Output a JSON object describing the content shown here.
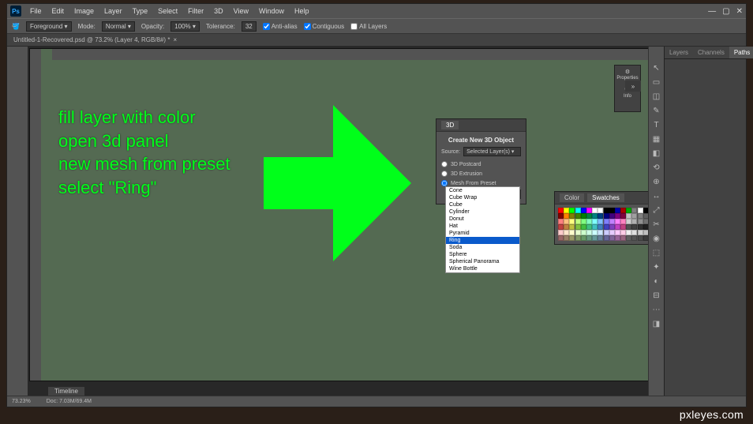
{
  "app": {
    "logo": "Ps"
  },
  "menu": [
    "File",
    "Edit",
    "Image",
    "Layer",
    "Type",
    "Select",
    "Filter",
    "3D",
    "View",
    "Window",
    "Help"
  ],
  "winctrl": {
    "min": "—",
    "max": "▢",
    "close": "✕"
  },
  "options": {
    "fill_label": "Foreground ▾",
    "mode_label": "Mode:",
    "mode_value": "Normal ▾",
    "opacity_label": "Opacity:",
    "opacity_value": "100% ▾",
    "tolerance_label": "Tolerance:",
    "tolerance_value": "32",
    "antialias": "Anti-alias",
    "contiguous": "Contiguous",
    "alllayers": "All Layers"
  },
  "doctab": {
    "title": "Untitled-1-Recovered.psd @ 73.2% (Layer 4, RGB/8#) *",
    "close": "×"
  },
  "tutorial": {
    "l1": "fill layer with color",
    "l2": "open 3d panel",
    "l3": "new mesh from preset",
    "l4": "select \"Ring\""
  },
  "three_d": {
    "tab": "3D",
    "title": "Create New 3D Object",
    "source_label": "Source:",
    "source_value": "Selected Layer(s) ▾",
    "opt_postcard": "3D Postcard",
    "opt_extrusion": "3D Extrusion",
    "opt_mesh": "Mesh From Preset",
    "preset_selected": "Cone ▾"
  },
  "presets": [
    "Cone",
    "Cube Wrap",
    "Cube",
    "Cylinder",
    "Donut",
    "Hat",
    "Pyramid",
    "Ring",
    "Soda",
    "Sphere",
    "Spherical Panorama",
    "Wine Bottle"
  ],
  "preset_highlight_index": 7,
  "swatches": {
    "tab1": "Color",
    "tab2": "Swatches",
    "colors": [
      "#ff0000",
      "#ffff00",
      "#00ff00",
      "#00ffff",
      "#0000ff",
      "#ff00ff",
      "#ffffff",
      "#fff",
      "#000",
      "#000",
      "#00a",
      "#a00",
      "#0a0",
      "#808080",
      "#fff",
      "#000",
      "#800000",
      "#ff8000",
      "#808000",
      "#408000",
      "#008000",
      "#008040",
      "#008080",
      "#004080",
      "#000080",
      "#400080",
      "#800080",
      "#800040",
      "#c0c0c0",
      "#a0a0a0",
      "#808080",
      "#606060",
      "#ff8080",
      "#ffc080",
      "#ffff80",
      "#c0ff80",
      "#80ff80",
      "#80ffc0",
      "#80ffff",
      "#80c0ff",
      "#8080ff",
      "#c080ff",
      "#ff80ff",
      "#ff80c0",
      "#d0d0d0",
      "#b0b0b0",
      "#909090",
      "#707070",
      "#c04040",
      "#c08040",
      "#c0c040",
      "#80c040",
      "#40c040",
      "#40c080",
      "#40c0c0",
      "#4080c0",
      "#4040c0",
      "#8040c0",
      "#c040c0",
      "#c04080",
      "#505050",
      "#404040",
      "#303030",
      "#202020",
      "#ffcccc",
      "#ffe6cc",
      "#ffffcc",
      "#e6ffcc",
      "#ccffcc",
      "#ccffe6",
      "#ccffff",
      "#cce6ff",
      "#ccccff",
      "#e6ccff",
      "#ffccff",
      "#ffcce6",
      "#f0f0f0",
      "#e0e0e0",
      "#d0d0d0",
      "#c0c0c0",
      "#996666",
      "#998066",
      "#999966",
      "#809966",
      "#669966",
      "#669980",
      "#669999",
      "#668099",
      "#666699",
      "#806699",
      "#996699",
      "#996680",
      "#606060",
      "#555",
      "#4a4a4a",
      "#3a3a3a"
    ]
  },
  "dock": {
    "properties": "Properties",
    "info": "Info"
  },
  "right_tabs": [
    "Layers",
    "Channels",
    "Paths"
  ],
  "status": {
    "zoom": "73.23%",
    "doc": "Doc: 7.03M/69.4M"
  },
  "timeline": "Timeline",
  "tools": [
    "↖",
    "▭",
    "◫",
    "✎",
    "T",
    "▦",
    "◧",
    "⟲",
    "⊕",
    "↔",
    "⤢",
    "✂",
    "◉",
    "⬚",
    "✦",
    "◐",
    "⊟",
    "⋯",
    "◨"
  ],
  "watermark": "pxleyes.com",
  "collapse": "»"
}
